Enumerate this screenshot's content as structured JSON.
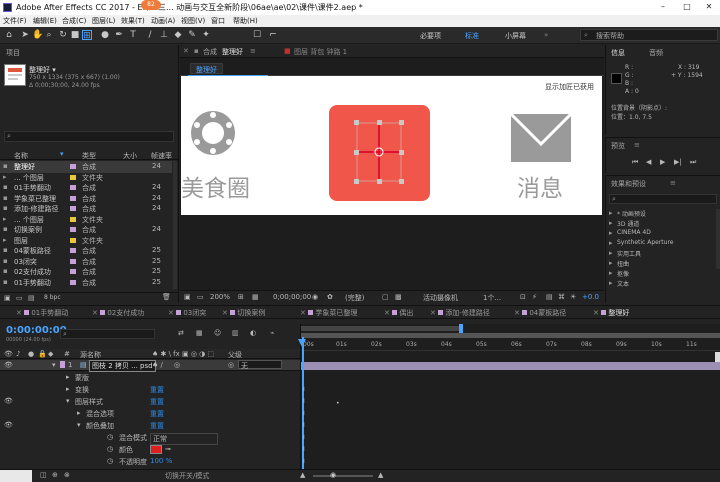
{
  "window": {
    "title": "Adobe After Effects CC 2017 - E:\\01三... 动画与交互全新阶段\\06ae\\ae\\02\\课件\\课件2.aep *",
    "badge": "82",
    "minimize": "–",
    "maximize": "□",
    "close": "✕"
  },
  "menu": [
    "文件(F)",
    "编辑(E)",
    "合成(C)",
    "图层(L)",
    "效果(T)",
    "动画(A)",
    "视图(V)",
    "窗口",
    "帮助(H)"
  ],
  "workspaces": {
    "essentials": "必要项",
    "standard": "标准",
    "small_screen": "小屏幕",
    "search_placeholder": "搜索帮助"
  },
  "project": {
    "tab": "项目",
    "comp_name": "整理好 ▾",
    "comp_dims": "750 x 1334 (375 x 667) (1.00)",
    "comp_dur": "Δ 0;00;30;00, 24.00 fps",
    "search": "⌕",
    "headers": {
      "name": "名称",
      "type": "类型",
      "size": "大小",
      "fps": "帧速率"
    },
    "items": [
      {
        "name": "整理好",
        "type": "合成",
        "fps": "24",
        "color": "#c8a0d8",
        "selected": true
      },
      {
        "name": "... 个图层",
        "type": "文件夹",
        "fps": "",
        "color": "#e8c83a"
      },
      {
        "name": "01手势翻动",
        "type": "合成",
        "fps": "24",
        "color": "#c8a0d8"
      },
      {
        "name": "学象菜已整理",
        "type": "合成",
        "fps": "24",
        "color": "#c8a0d8"
      },
      {
        "name": "添加-修建路径",
        "type": "合成",
        "fps": "24",
        "color": "#c8a0d8"
      },
      {
        "name": "... 个图层",
        "type": "文件夹",
        "fps": "",
        "color": "#e8c83a"
      },
      {
        "name": "切换案例",
        "type": "合成",
        "fps": "24",
        "color": "#c8a0d8"
      },
      {
        "name": "图层",
        "type": "文件夹",
        "fps": "",
        "color": "#e8c83a"
      },
      {
        "name": "04蒙板路径",
        "type": "合成",
        "fps": "25",
        "color": "#c8a0d8"
      },
      {
        "name": "03闭突",
        "type": "合成",
        "fps": "25",
        "color": "#c8a0d8"
      },
      {
        "name": "02支付成功",
        "type": "合成",
        "fps": "25",
        "color": "#c8a0d8"
      },
      {
        "name": "01手势翻动",
        "type": "合成",
        "fps": "25",
        "color": "#c8a0d8"
      }
    ],
    "bpc": "8 bpc"
  },
  "composition": {
    "tab_close": "✕",
    "tab_lock": "合成",
    "tab_name": "整理好",
    "tab_menu": "≡",
    "layer_tab": "图层 背包 钟路 1",
    "breadcrumb": "整理好",
    "canvas": {
      "toggle_text": "显示加匠已获用",
      "label_food": "美食圈",
      "label_msg": "消息",
      "accent": "#f0574a",
      "gray": "#9a9a9a"
    },
    "footer": {
      "zoom": "200%",
      "timecode": "0;00;00;00",
      "resolution": "(完整)",
      "camera": "活动摄像机",
      "views": "1个...",
      "offset": "+0.0"
    }
  },
  "info_panel": {
    "tab1": "信息",
    "tab2": "音频",
    "r": "R :",
    "g": "G :",
    "b": "B :",
    "a": "A : 0",
    "x": "X : 319",
    "y": "+ Y : 1594",
    "pos_label": "位置背景（阴影点）:",
    "pos_val": "位置：1.0, 7.5"
  },
  "preview": {
    "tab": "预览",
    "menu": "≡"
  },
  "effects": {
    "tab": "效果和预设",
    "menu": "≡",
    "search": "⌕",
    "items": [
      "* 动画预设",
      "3D 通道",
      "CINEMA 4D",
      "Synthetic Aperture",
      "实用工具",
      "扭曲",
      "抠像",
      "文本"
    ]
  },
  "timeline": {
    "tabs": [
      "01手势翻动",
      "02支付成功",
      "03闭突",
      "切换案例",
      "学象菜已整理",
      "偶出",
      "添加-修建路径",
      "04蒙板路径",
      "整理好"
    ],
    "timecode": "0:00:00:00",
    "timecode_sub": "00000 (24.00 fps)",
    "search": "⌕",
    "col_name": "源名称",
    "col_mode": "父级",
    "layer": {
      "num": "1",
      "name": "图枝 2 拷贝 ... psd",
      "parent": "无"
    },
    "props": [
      {
        "label": "蒙版",
        "indent": 1,
        "value": ""
      },
      {
        "label": "变换",
        "indent": 1,
        "value": "重置"
      },
      {
        "label": "图层样式",
        "indent": 1,
        "value": "重置"
      },
      {
        "label": "混合选项",
        "indent": 2,
        "value": "重置"
      },
      {
        "label": "颜色叠加",
        "indent": 2,
        "value": "重置"
      },
      {
        "label": "混合模式",
        "indent": 3,
        "value": "正常"
      },
      {
        "label": "颜色",
        "indent": 3,
        "value": ""
      },
      {
        "label": "不透明度",
        "indent": 3,
        "value": "100 %"
      }
    ],
    "ticks": [
      "00s",
      "01s",
      "02s",
      "03s",
      "04s",
      "05s",
      "06s",
      "07s",
      "08s",
      "09s",
      "10s",
      "11s"
    ],
    "footer": "切换开关/模式",
    "overlay_color": "#e02020"
  }
}
